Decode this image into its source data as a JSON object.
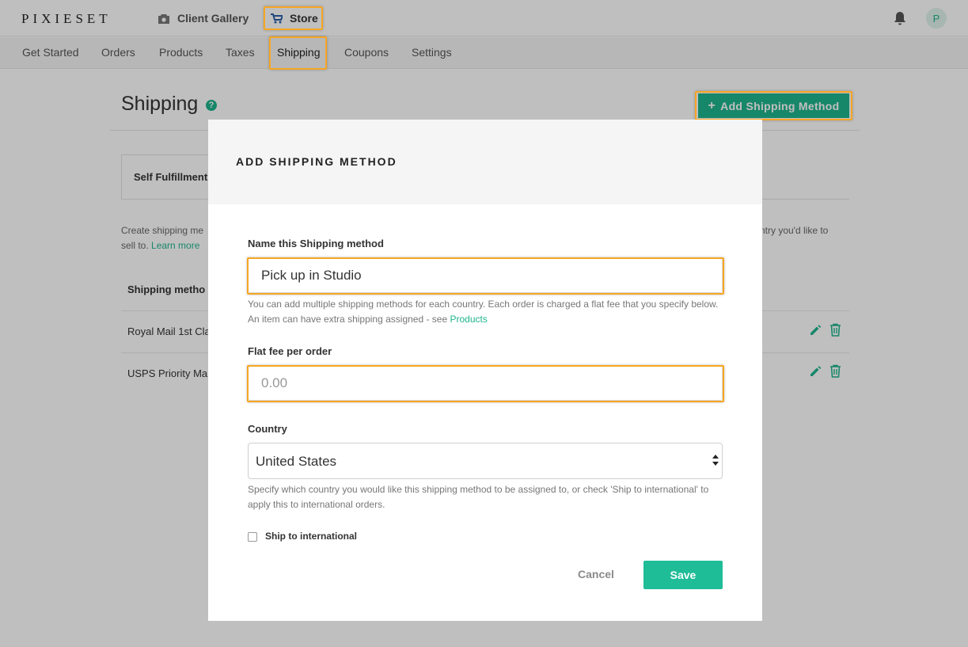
{
  "app": {
    "logo_text": "PIXIESET",
    "nav": {
      "client_gallery_label": "Client Gallery",
      "store_label": "Store"
    },
    "avatar_initial": "P"
  },
  "subnav": {
    "items": [
      {
        "label": "Get Started"
      },
      {
        "label": "Orders"
      },
      {
        "label": "Products"
      },
      {
        "label": "Taxes"
      },
      {
        "label": "Shipping",
        "active": true
      },
      {
        "label": "Coupons"
      },
      {
        "label": "Settings"
      }
    ]
  },
  "page": {
    "title": "Shipping",
    "help_glyph": "?",
    "add_button_label": "Add Shipping Method",
    "add_button_glyph": "+",
    "tab_label": "Self Fulfillment",
    "description_line1": "Create shipping me",
    "description_line2_prefix": "sell to.",
    "learn_more_label": "Learn more",
    "description_right": "ntry you'd like to",
    "table_header": "Shipping metho",
    "rows": [
      {
        "name": "Royal Mail 1st Cla"
      },
      {
        "name": "USPS Priority Ma"
      }
    ]
  },
  "modal": {
    "title": "ADD SHIPPING METHOD",
    "name_label": "Name this Shipping method",
    "name_value": "Pick up in Studio",
    "name_help": "You can add multiple shipping methods for each country. Each order is charged a flat fee that you specify below. An item can have extra shipping assigned - see",
    "name_help_link": "Products",
    "fee_label": "Flat fee per order",
    "fee_placeholder": "0.00",
    "country_label": "Country",
    "country_value": "United States",
    "country_help": "Specify which country you would like this shipping method to be assigned to, or check 'Ship to international' to apply this to international orders.",
    "ship_international_label": "Ship to international",
    "ship_international_checked": false,
    "cancel_label": "Cancel",
    "save_label": "Save"
  },
  "colors": {
    "accent": "#1fb48d",
    "save_button": "#1fbc98",
    "highlight": "#f6a623"
  }
}
